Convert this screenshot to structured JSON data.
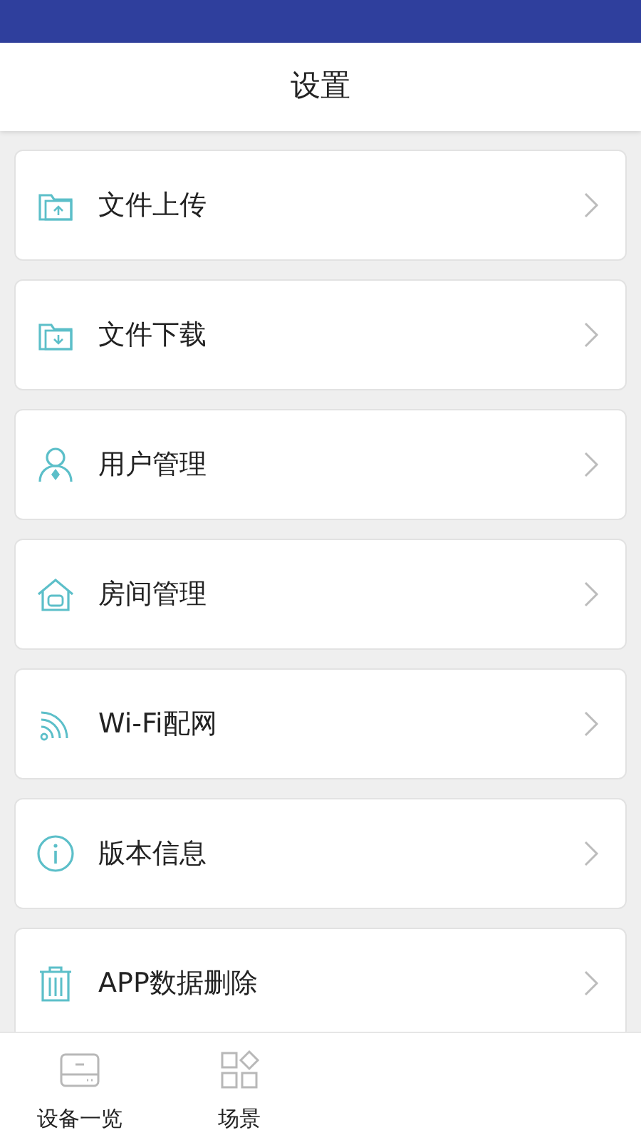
{
  "header": {
    "title": "设置"
  },
  "items": [
    {
      "label": "文件上传"
    },
    {
      "label": "文件下载"
    },
    {
      "label": "用户管理"
    },
    {
      "label": "房间管理"
    },
    {
      "label": "Wi-Fi配网"
    },
    {
      "label": "版本信息"
    },
    {
      "label": "APP数据删除"
    }
  ],
  "bottom_nav": [
    {
      "label": "设备一览"
    },
    {
      "label": "场景"
    }
  ]
}
